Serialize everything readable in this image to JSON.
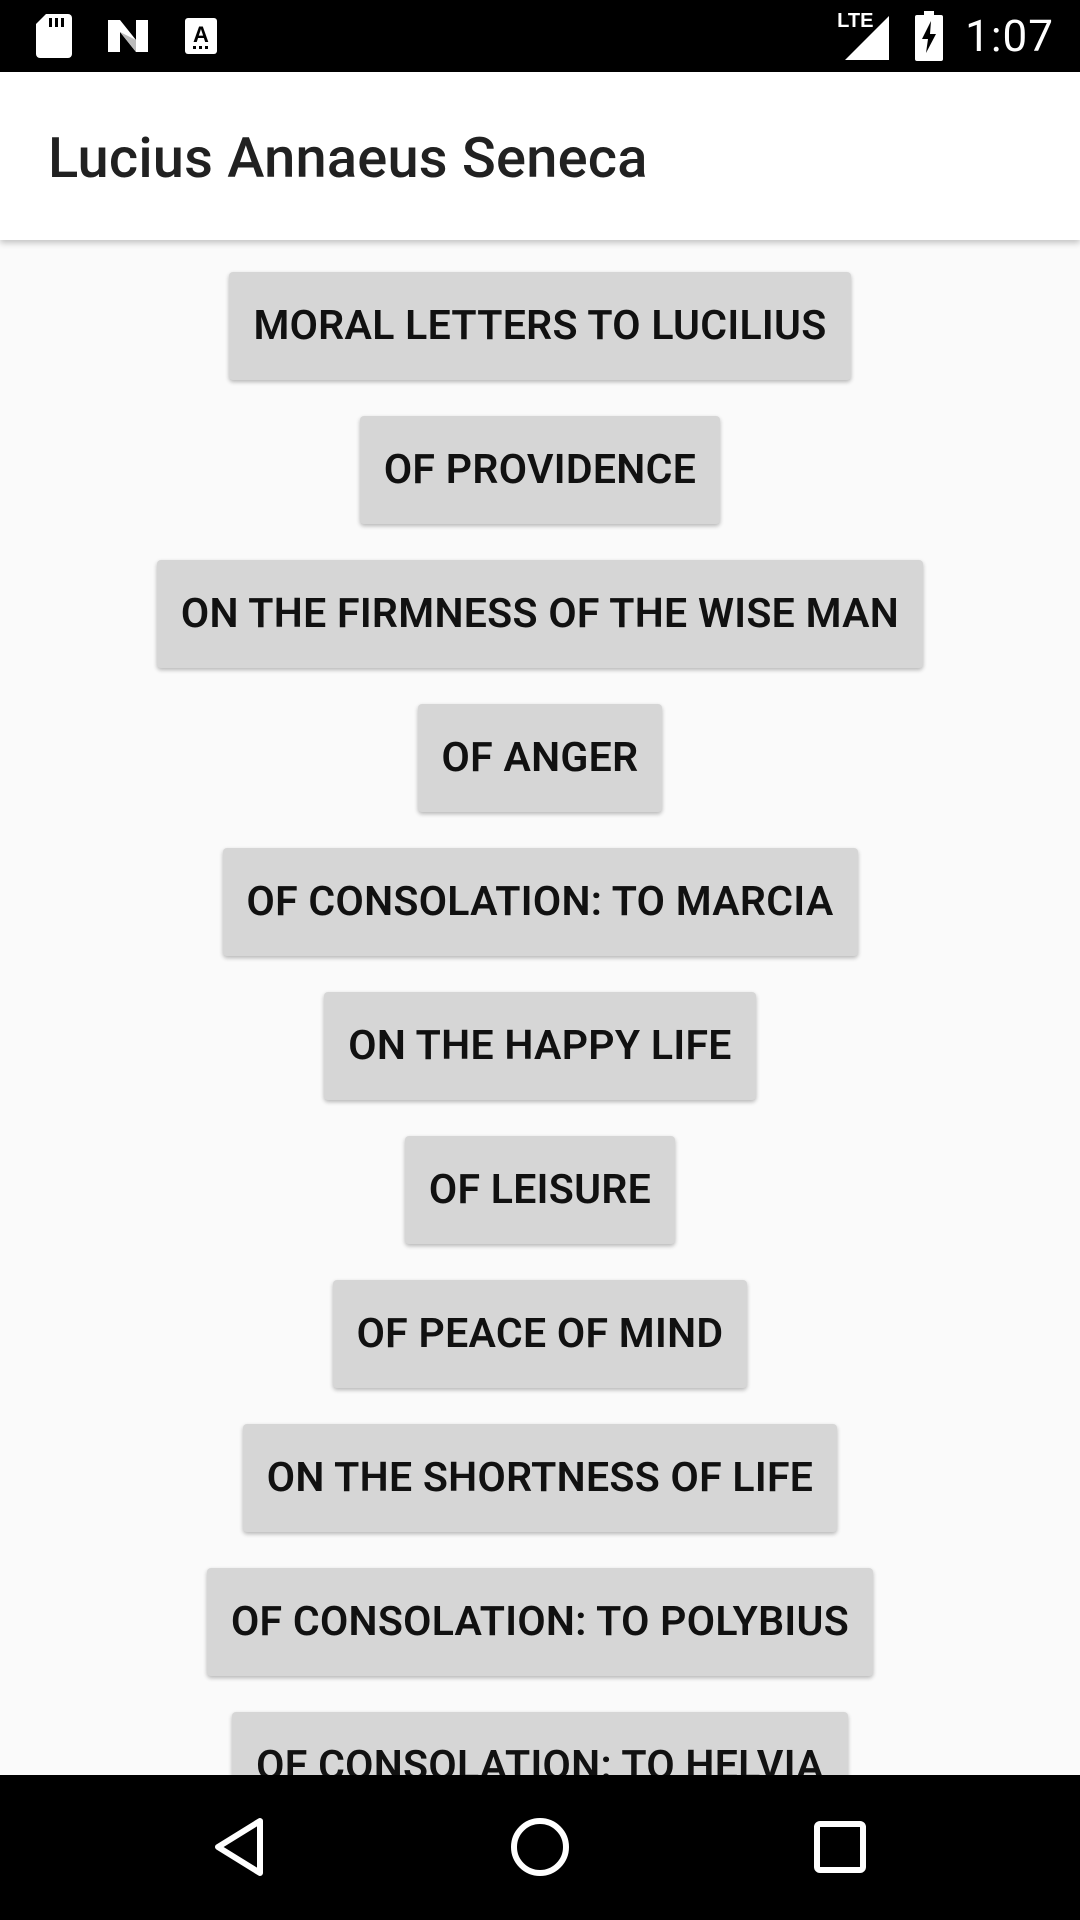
{
  "status_bar": {
    "icons_left": [
      "sd-card-icon",
      "n-logo-icon",
      "keyboard-a-icon"
    ],
    "network": "LTE",
    "time": "1:07"
  },
  "app_bar": {
    "title": "Lucius Annaeus Seneca"
  },
  "books": [
    {
      "label": "MORAL LETTERS TO LUCILIUS"
    },
    {
      "label": "OF PROVIDENCE"
    },
    {
      "label": "ON THE FIRMNESS OF THE WISE MAN"
    },
    {
      "label": "OF ANGER"
    },
    {
      "label": "OF CONSOLATION: TO MARCIA"
    },
    {
      "label": "ON THE HAPPY LIFE"
    },
    {
      "label": "OF LEISURE"
    },
    {
      "label": "OF PEACE OF MIND"
    },
    {
      "label": "ON THE SHORTNESS OF LIFE"
    },
    {
      "label": "OF CONSOLATION: TO POLYBIUS"
    },
    {
      "label": "OF CONSOLATION: TO HELVIA"
    }
  ],
  "nav_bar": {
    "buttons": [
      "back-icon",
      "home-icon",
      "recents-icon"
    ]
  },
  "colors": {
    "button_bg": "#d6d6d6",
    "page_bg": "#fafafa",
    "bar_bg": "#000000"
  }
}
